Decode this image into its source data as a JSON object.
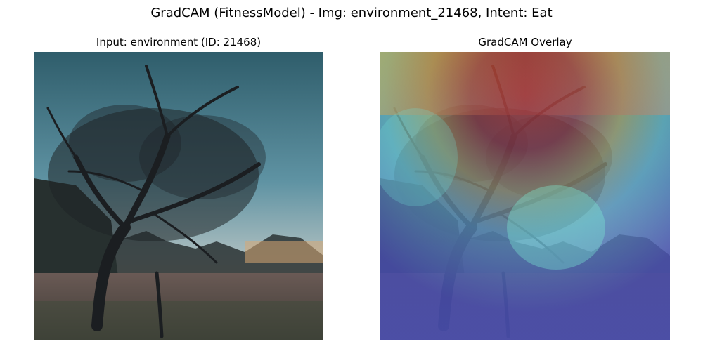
{
  "figure": {
    "suptitle": "GradCAM (FitnessModel) - Img: environment_21468, Intent: Eat"
  },
  "panels": [
    {
      "title": "Input: environment (ID: 21468)",
      "content": "tree-photo"
    },
    {
      "title": "GradCAM Overlay",
      "content": "tree-photo-with-heatmap"
    }
  ],
  "colors": {
    "sky_top": "#2f5d6b",
    "sky_mid": "#5f93a3",
    "sky_horizon": "#b9c4c3",
    "sunset_glow": "#d9a873",
    "ground": "#5a4d48",
    "tree": "#1e2226",
    "heat_red": "#c0392b",
    "heat_yellow": "#d9c64a",
    "heat_cyan": "#6fe0d6",
    "heat_blue": "#4a4fb0"
  }
}
